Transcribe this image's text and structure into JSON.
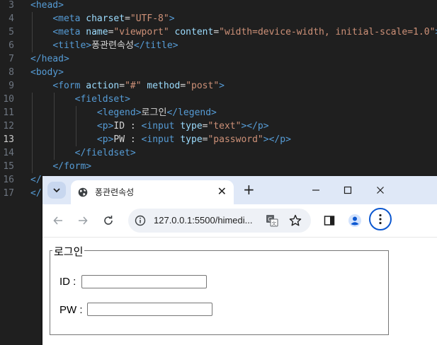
{
  "editor": {
    "lines": [
      {
        "num": "3",
        "indent": "",
        "tokens": [
          [
            "tag",
            "<head>"
          ]
        ]
      },
      {
        "num": "4",
        "indent": "    ",
        "tokens": [
          [
            "tag",
            "<meta "
          ],
          [
            "attr",
            "charset"
          ],
          [
            "txt",
            "="
          ],
          [
            "str",
            "\"UTF-8\""
          ],
          [
            "tag",
            ">"
          ]
        ]
      },
      {
        "num": "5",
        "indent": "    ",
        "tokens": [
          [
            "tag",
            "<meta "
          ],
          [
            "attr",
            "name"
          ],
          [
            "txt",
            "="
          ],
          [
            "str",
            "\"viewport\""
          ],
          [
            "txt",
            " "
          ],
          [
            "attr",
            "content"
          ],
          [
            "txt",
            "="
          ],
          [
            "str",
            "\"width=device-width, initial-scale=1.0\""
          ],
          [
            "tag",
            ">"
          ]
        ]
      },
      {
        "num": "6",
        "indent": "    ",
        "tokens": [
          [
            "tag",
            "<title>"
          ],
          [
            "kr",
            "퐁관련속성"
          ],
          [
            "tag",
            "</title>"
          ]
        ]
      },
      {
        "num": "7",
        "indent": "",
        "tokens": [
          [
            "tag",
            "</head>"
          ]
        ]
      },
      {
        "num": "8",
        "indent": "",
        "tokens": [
          [
            "tag",
            "<body>"
          ]
        ]
      },
      {
        "num": "9",
        "indent": "    ",
        "tokens": [
          [
            "tag",
            "<form "
          ],
          [
            "attr",
            "action"
          ],
          [
            "txt",
            "="
          ],
          [
            "str",
            "\"#\""
          ],
          [
            "txt",
            " "
          ],
          [
            "attr",
            "method"
          ],
          [
            "txt",
            "="
          ],
          [
            "str",
            "\"post\""
          ],
          [
            "tag",
            ">"
          ]
        ]
      },
      {
        "num": "10",
        "indent": "        ",
        "tokens": [
          [
            "tag",
            "<fieldset>"
          ]
        ]
      },
      {
        "num": "11",
        "indent": "            ",
        "tokens": [
          [
            "tag",
            "<legend>"
          ],
          [
            "kr",
            "로그인"
          ],
          [
            "tag",
            "</legend>"
          ]
        ]
      },
      {
        "num": "12",
        "indent": "            ",
        "tokens": [
          [
            "tag",
            "<p>"
          ],
          [
            "txt",
            "ID : "
          ],
          [
            "tag",
            "<input "
          ],
          [
            "attr",
            "type"
          ],
          [
            "txt",
            "="
          ],
          [
            "str",
            "\"text\""
          ],
          [
            "tag",
            "></p>"
          ]
        ]
      },
      {
        "num": "13",
        "indent": "            ",
        "tokens": [
          [
            "tag",
            "<p>"
          ],
          [
            "txt",
            "PW : "
          ],
          [
            "tag",
            "<input "
          ],
          [
            "attr",
            "type"
          ],
          [
            "txt",
            "="
          ],
          [
            "str",
            "\"password\""
          ],
          [
            "tag",
            "></p>"
          ]
        ]
      },
      {
        "num": "14",
        "indent": "        ",
        "tokens": [
          [
            "tag",
            "</fieldset>"
          ]
        ]
      },
      {
        "num": "15",
        "indent": "    ",
        "tokens": [
          [
            "tag",
            "</form>"
          ]
        ]
      },
      {
        "num": "16",
        "indent": "",
        "tokens": [
          [
            "tag",
            "</"
          ]
        ]
      },
      {
        "num": "17",
        "indent": "",
        "tokens": [
          [
            "tag",
            "</"
          ]
        ]
      }
    ],
    "active_line": "13"
  },
  "browser": {
    "tab_title": "퐁관련속성",
    "tab_close": "✕",
    "new_tab": "+",
    "url": "127.0.0.1:5500/himedi..."
  },
  "page": {
    "legend": "로그인",
    "id_label": "ID :",
    "pw_label": "PW :"
  },
  "colors": {
    "accent": "#0b57d0",
    "tabstrip": "#dfe8f7",
    "editor_bg": "#1f1f1f"
  }
}
